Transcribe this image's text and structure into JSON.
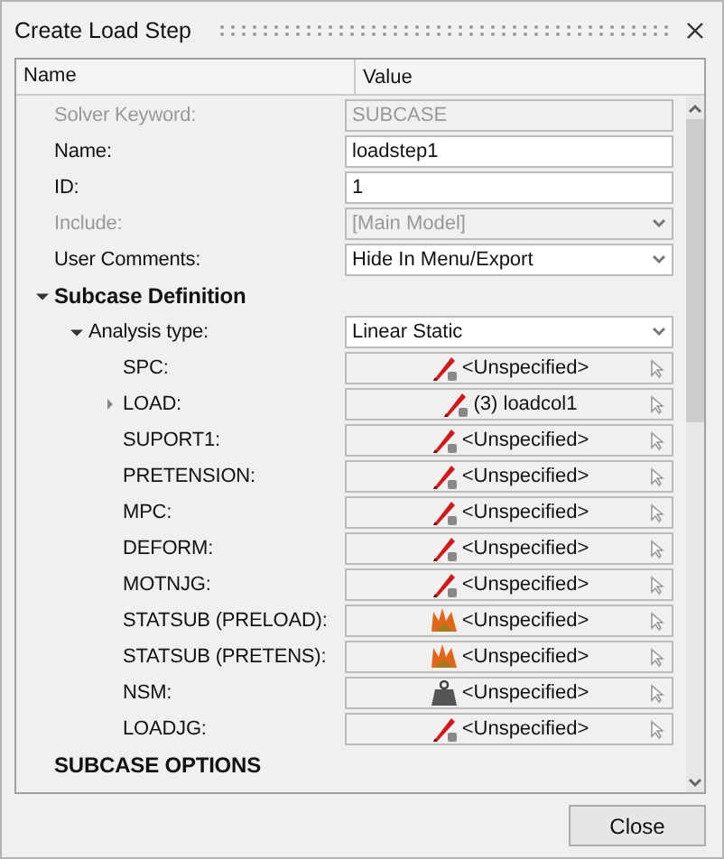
{
  "window": {
    "title": "Create Load Step"
  },
  "table": {
    "columns": [
      "Name",
      "Value"
    ],
    "rows": [
      {
        "kind": "readonly",
        "label": "Solver Keyword:",
        "value": "SUBCASE"
      },
      {
        "kind": "text",
        "label": "Name:",
        "value": "loadstep1"
      },
      {
        "kind": "text",
        "label": "ID:",
        "value": "1"
      },
      {
        "kind": "dropdown",
        "label": "Include:",
        "value": "[Main Model]",
        "disabled": true
      },
      {
        "kind": "dropdown",
        "label": "User Comments:",
        "value": "Hide In Menu/Export",
        "disabled": false
      },
      {
        "kind": "section",
        "label": "Subcase Definition",
        "expanded": true,
        "children": [
          {
            "kind": "dropdown",
            "label": "Analysis type:",
            "value": "Linear Static",
            "disabled": false,
            "expanded": true,
            "children": [
              {
                "kind": "load-entity",
                "label": "SPC:",
                "value": "<Unspecified>"
              },
              {
                "kind": "load-entity",
                "label": "LOAD:",
                "value": "(3) loadcol1",
                "expanded": false
              },
              {
                "kind": "load-entity",
                "label": "SUPORT1:",
                "value": "<Unspecified>"
              },
              {
                "kind": "load-entity",
                "label": "PRETENSION:",
                "value": "<Unspecified>"
              },
              {
                "kind": "load-entity",
                "label": "MPC:",
                "value": "<Unspecified>"
              },
              {
                "kind": "load-entity",
                "label": "DEFORM:",
                "value": "<Unspecified>"
              },
              {
                "kind": "load-entity",
                "label": "MOTNJG:",
                "value": "<Unspecified>"
              },
              {
                "kind": "subcase-entity",
                "label": "STATSUB (PRELOAD):",
                "value": "<Unspecified>"
              },
              {
                "kind": "subcase-entity",
                "label": "STATSUB (PRETENS):",
                "value": "<Unspecified>"
              },
              {
                "kind": "mass-entity",
                "label": "NSM:",
                "value": "<Unspecified>"
              },
              {
                "kind": "load-entity",
                "label": "LOADJG:",
                "value": "<Unspecified>"
              }
            ]
          }
        ]
      },
      {
        "kind": "section",
        "label": "SUBCASE OPTIONS"
      }
    ]
  },
  "buttons": [
    "Close"
  ]
}
